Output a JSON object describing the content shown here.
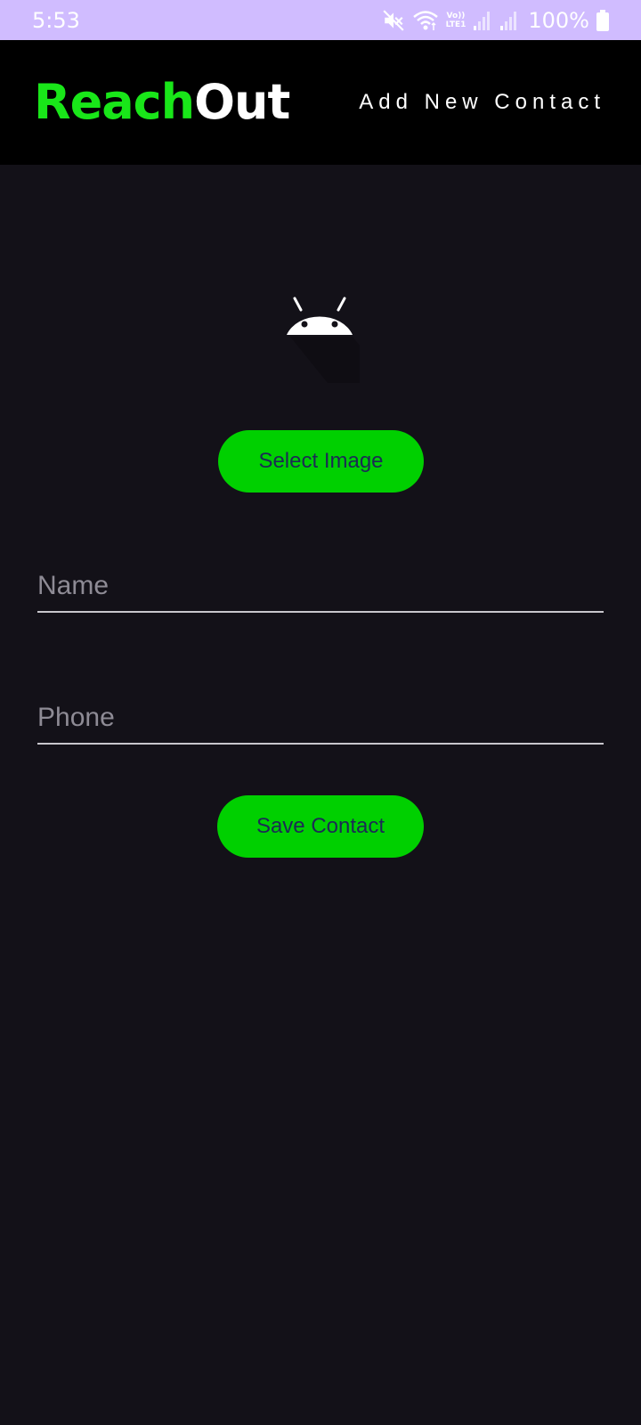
{
  "status_bar": {
    "time": "5:53",
    "network_top": "Vo))",
    "network_bottom": "LTE1",
    "battery": "100%"
  },
  "app_bar": {
    "logo_part1": "Reach",
    "logo_part2": "Out",
    "title": "Add New Contact"
  },
  "form": {
    "select_image_label": "Select Image",
    "name_placeholder": "Name",
    "name_value": "",
    "phone_placeholder": "Phone",
    "phone_value": "",
    "save_label": "Save Contact"
  },
  "colors": {
    "status_bar": "#d0bcff",
    "app_bar": "#000000",
    "background": "#131118",
    "accent_green": "#00d000",
    "logo_green": "#19e619",
    "button_text": "#1c2a55"
  },
  "icons": {
    "avatar": "android-icon",
    "mute": "mute-icon",
    "wifi": "wifi-icon",
    "signal": "signal-icon",
    "battery": "battery-icon"
  }
}
